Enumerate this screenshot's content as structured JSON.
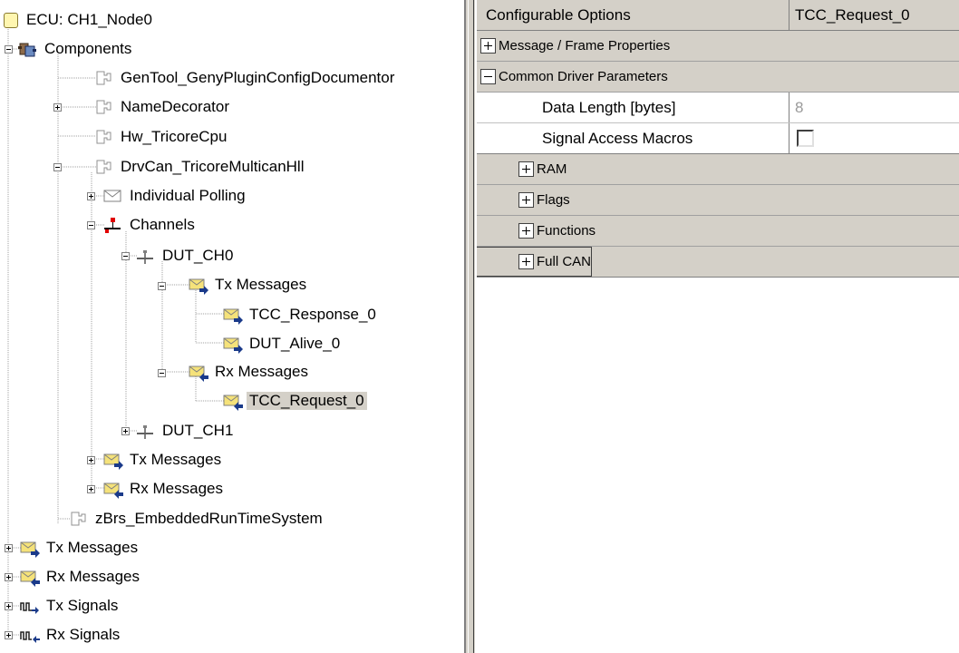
{
  "tree": {
    "nodes": [
      {
        "label": "ECU: CH1_Node0",
        "icon": "ecu-icon"
      },
      {
        "label": "Components",
        "icon": "components-icon"
      },
      {
        "label": "GenTool_GenyPluginConfigDocumentor",
        "icon": "plugin-icon"
      },
      {
        "label": "NameDecorator",
        "icon": "plugin-icon"
      },
      {
        "label": "Hw_TricoreCpu",
        "icon": "plugin-icon"
      },
      {
        "label": "DrvCan_TricoreMulticanHll",
        "icon": "plugin-icon"
      },
      {
        "label": "Individual Polling",
        "icon": "envelope-icon"
      },
      {
        "label": "Channels",
        "icon": "channels-icon"
      },
      {
        "label": "DUT_CH0",
        "icon": "channel-icon"
      },
      {
        "label": "Tx Messages",
        "icon": "tx-message-icon"
      },
      {
        "label": "TCC_Response_0",
        "icon": "tx-message-icon"
      },
      {
        "label": "DUT_Alive_0",
        "icon": "tx-message-icon"
      },
      {
        "label": "Rx Messages",
        "icon": "rx-message-icon"
      },
      {
        "label": "TCC_Request_0",
        "icon": "rx-message-icon"
      },
      {
        "label": "DUT_CH1",
        "icon": "channel-icon"
      },
      {
        "label": "Tx Messages",
        "icon": "tx-message-icon"
      },
      {
        "label": "Rx Messages",
        "icon": "rx-message-icon"
      },
      {
        "label": "zBrs_EmbeddedRunTimeSystem",
        "icon": "plugin-icon"
      },
      {
        "label": "Tx Messages",
        "icon": "tx-message-icon"
      },
      {
        "label": "Rx Messages",
        "icon": "rx-message-icon"
      },
      {
        "label": "Tx Signals",
        "icon": "tx-signal-icon"
      },
      {
        "label": "Rx Signals",
        "icon": "rx-signal-icon"
      }
    ],
    "selected_label": "TCC_Request_0"
  },
  "grid": {
    "header": {
      "col1": "Configurable Options",
      "col2": "TCC_Request_0"
    },
    "rows": [
      {
        "label": "Message / Frame Properties",
        "expanded": false
      },
      {
        "label": "Common Driver Parameters",
        "expanded": true
      },
      {
        "label": "Data Length [bytes]",
        "value": "8"
      },
      {
        "label": "Signal Access Macros",
        "checked": false
      },
      {
        "label": "RAM",
        "expanded": false
      },
      {
        "label": "Flags",
        "expanded": false
      },
      {
        "label": "Functions",
        "expanded": false
      },
      {
        "label": "Full CAN",
        "expanded": false
      }
    ]
  },
  "colors": {
    "panel_gray": "#d4d0c8",
    "selection": "#d4d0c8",
    "channel_red": "#e00000",
    "envelope_yellow": "#f5e27a",
    "arrow_blue": "#1a3a8a"
  }
}
